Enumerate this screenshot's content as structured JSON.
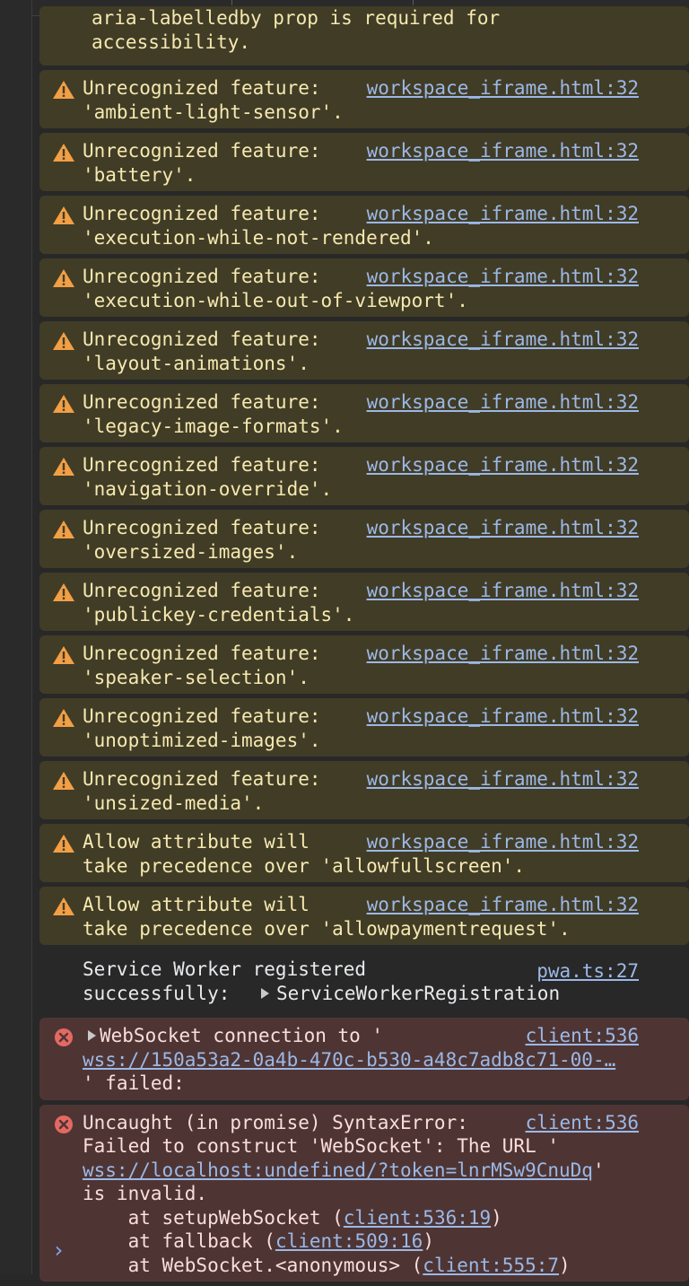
{
  "partial_top": {
    "line1": "aria-labelledby prop is required for",
    "line2": "accessibility."
  },
  "warnings": [
    {
      "l1": "Unrecognized feature: ",
      "l2": "'ambient-light-sensor'.",
      "src": "workspace_iframe.html:32"
    },
    {
      "l1": "Unrecognized feature: ",
      "l2": "'battery'.",
      "src": "workspace_iframe.html:32"
    },
    {
      "l1": "Unrecognized feature: ",
      "l2": "'execution-while-not-rendered'.",
      "src": "workspace_iframe.html:32"
    },
    {
      "l1": "Unrecognized feature: ",
      "l2": "'execution-while-out-of-viewport'.",
      "src": "workspace_iframe.html:32"
    },
    {
      "l1": "Unrecognized feature: ",
      "l2": "'layout-animations'.",
      "src": "workspace_iframe.html:32"
    },
    {
      "l1": "Unrecognized feature: ",
      "l2": "'legacy-image-formats'.",
      "src": "workspace_iframe.html:32"
    },
    {
      "l1": "Unrecognized feature: ",
      "l2": "'navigation-override'.",
      "src": "workspace_iframe.html:32"
    },
    {
      "l1": "Unrecognized feature: ",
      "l2": "'oversized-images'.",
      "src": "workspace_iframe.html:32"
    },
    {
      "l1": "Unrecognized feature: ",
      "l2": "'publickey-credentials'.",
      "src": "workspace_iframe.html:32"
    },
    {
      "l1": "Unrecognized feature: ",
      "l2": "'speaker-selection'.",
      "src": "workspace_iframe.html:32"
    },
    {
      "l1": "Unrecognized feature: ",
      "l2": "'unoptimized-images'.",
      "src": "workspace_iframe.html:32"
    },
    {
      "l1": "Unrecognized feature: ",
      "l2": "'unsized-media'.",
      "src": "workspace_iframe.html:32"
    },
    {
      "l1": "Allow attribute will",
      "l2": "take precedence over 'allowfullscreen'.",
      "src": "workspace_iframe.html:32"
    },
    {
      "l1": "Allow attribute will",
      "l2": "take precedence over 'allowpaymentrequest'.",
      "src": "workspace_iframe.html:32"
    }
  ],
  "log": {
    "l1": "Service Worker registered",
    "l2": "successfully: ",
    "obj": "ServiceWorkerRegistration",
    "src": "pwa.ts:27"
  },
  "error1": {
    "l1": "WebSocket connection to '",
    "url": "wss://150a53a2-0a4b-470c-b530-a48c7adb8c71-00-…",
    "l3": "' failed:",
    "src": "client:536"
  },
  "error2": {
    "l1": "Uncaught (in promise) SyntaxError:",
    "l2": "Failed to construct 'WebSocket': The URL '",
    "url": "wss://localhost:undefined/?token=lnrMSw9CnuDq",
    "url_after": "'",
    "l4": "is invalid.",
    "stack": [
      {
        "pre": "    at setupWebSocket (",
        "link": "client:536:19",
        "post": ")"
      },
      {
        "pre": "    at fallback (",
        "link": "client:509:16",
        "post": ")"
      },
      {
        "pre": "    at WebSocket.<anonymous> (",
        "link": "client:555:7",
        "post": ")"
      }
    ],
    "src": "client:536"
  },
  "prompt_symbol": "›",
  "colors": {
    "warning_bg": "#413c26",
    "warning_icon": "#f29f45",
    "error_bg": "#4e3534",
    "error_icon": "#e46962",
    "link": "#9cb8e6"
  }
}
